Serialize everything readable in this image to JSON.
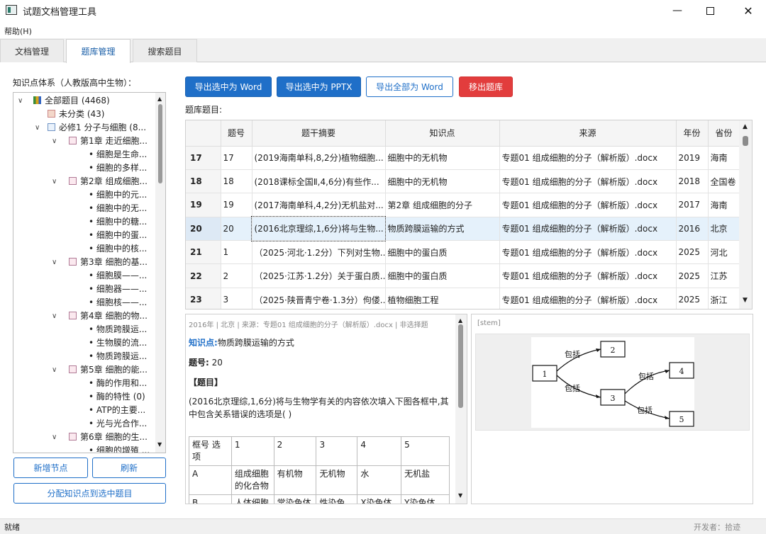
{
  "window": {
    "title": "试题文档管理工具",
    "min_icon": "minimize-icon",
    "max_icon": "maximize-icon",
    "close_icon": "close-icon"
  },
  "menu": {
    "help": "帮助(H)"
  },
  "tabs": [
    {
      "label": "文档管理"
    },
    {
      "label": "题库管理"
    },
    {
      "label": "搜索题目"
    }
  ],
  "left": {
    "title": "知识点体系（人教版高中生物）：",
    "tree": [
      {
        "label": "全部题目 (4468)",
        "level": 0,
        "expanded": true,
        "icon": "color-blocks-icon"
      },
      {
        "label": "未分类 (43)",
        "level": 1,
        "icon": "note-icon"
      },
      {
        "label": "必修1 分子与细胞 (8...",
        "level": 1,
        "expanded": true,
        "icon": "book-icon"
      },
      {
        "label": "第1章 走近细胞...",
        "level": 2,
        "expanded": true,
        "icon": "doc-icon"
      },
      {
        "label": "细胞是生命...",
        "level": 3
      },
      {
        "label": "细胞的多样...",
        "level": 3
      },
      {
        "label": "第2章 组成细胞...",
        "level": 2,
        "expanded": true,
        "icon": "doc-icon"
      },
      {
        "label": "细胞中的元...",
        "level": 3
      },
      {
        "label": "细胞中的无...",
        "level": 3
      },
      {
        "label": "细胞中的糖...",
        "level": 3
      },
      {
        "label": "细胞中的蛋...",
        "level": 3
      },
      {
        "label": "细胞中的核...",
        "level": 3
      },
      {
        "label": "第3章 细胞的基...",
        "level": 2,
        "expanded": true,
        "icon": "doc-icon"
      },
      {
        "label": "细胞膜——...",
        "level": 3
      },
      {
        "label": "细胞器——...",
        "level": 3
      },
      {
        "label": "细胞核——...",
        "level": 3
      },
      {
        "label": "第4章 细胞的物...",
        "level": 2,
        "expanded": true,
        "icon": "doc-icon"
      },
      {
        "label": "物质跨膜运...",
        "level": 3
      },
      {
        "label": "生物膜的流...",
        "level": 3
      },
      {
        "label": "物质跨膜运...",
        "level": 3
      },
      {
        "label": "第5章 细胞的能...",
        "level": 2,
        "expanded": true,
        "icon": "doc-icon"
      },
      {
        "label": "酶的作用和...",
        "level": 3
      },
      {
        "label": "酶的特性 (0)",
        "level": 3
      },
      {
        "label": "ATP的主要...",
        "level": 3
      },
      {
        "label": "光与光合作...",
        "level": 3
      },
      {
        "label": "第6章 细胞的生...",
        "level": 2,
        "expanded": true,
        "icon": "doc-icon"
      },
      {
        "label": "细胞的增殖 ...",
        "level": 3
      }
    ],
    "add_node": "新增节点",
    "refresh": "刷新",
    "assign": "分配知识点到选中题目"
  },
  "toolbar": {
    "export_word": "导出选中为 Word",
    "export_pptx": "导出选中为 PPTX",
    "export_all": "导出全部为 Word",
    "remove": "移出题库"
  },
  "table": {
    "label": "题库题目:",
    "headers": [
      "题号",
      "题干摘要",
      "知识点",
      "来源",
      "年份",
      "省份"
    ],
    "rows": [
      {
        "rh": "17",
        "no": "17",
        "stem": "(2019海南单科,8,2分)植物细胞...",
        "kp": "细胞中的无机物",
        "src": "专题01 组成细胞的分子（解析版）.docx",
        "year": "2019",
        "prov": "海南"
      },
      {
        "rh": "18",
        "no": "18",
        "stem": "(2018课标全国Ⅱ,4,6分)有些作...",
        "kp": "细胞中的无机物",
        "src": "专题01 组成细胞的分子（解析版）.docx",
        "year": "2018",
        "prov": "全国卷"
      },
      {
        "rh": "19",
        "no": "19",
        "stem": "(2017海南单科,4,2分)无机盐对...",
        "kp": "第2章 组成细胞的分子",
        "src": "专题01 组成细胞的分子（解析版）.docx",
        "year": "2017",
        "prov": "海南"
      },
      {
        "rh": "20",
        "no": "20",
        "stem": "(2016北京理综,1,6分)将与生物...",
        "kp": "物质跨膜运输的方式",
        "src": "专题01 组成细胞的分子（解析版）.docx",
        "year": "2016",
        "prov": "北京",
        "selected": true
      },
      {
        "rh": "21",
        "no": "1",
        "stem": "（2025·河北·1.2分）下列对生物...",
        "kp": "细胞中的蛋白质",
        "src": "专题01 组成细胞的分子（解析版）.docx",
        "year": "2025",
        "prov": "河北"
      },
      {
        "rh": "22",
        "no": "2",
        "stem": "（2025·江苏·1.2分）关于蛋白质...",
        "kp": "细胞中的蛋白质",
        "src": "专题01 组成细胞的分子（解析版）.docx",
        "year": "2025",
        "prov": "江苏"
      },
      {
        "rh": "23",
        "no": "3",
        "stem": "（2025·陕晋青宁卷·1.3分）佝偻...",
        "kp": "植物细胞工程",
        "src": "专题01 组成细胞的分子（解析版）.docx",
        "year": "2025",
        "prov": "浙江"
      }
    ]
  },
  "detail": {
    "meta": "2016年 | 北京 | 来源：专题01 组成细胞的分子（解析版）.docx | 非选择题",
    "kp_label": "知识点:",
    "kp_value": "物质跨膜运输的方式",
    "no_label": "题号:",
    "no_value": "20",
    "section": "【题目】",
    "question": "(2016北京理综,1,6分)将与生物学有关的内容依次填入下图各框中,其中包含关系错误的选项是( )",
    "options_table": [
      [
        "框号 选项",
        "1",
        "2",
        "3",
        "4",
        "5"
      ],
      [
        "A",
        "组成细胞的化合物",
        "有机物",
        "无机物",
        "水",
        "无机盐"
      ],
      [
        "B",
        "人体细胞",
        "常染色体",
        "性染色",
        "X染色体",
        "Y染色体"
      ]
    ]
  },
  "stem_panel": {
    "label": "[stem]",
    "diagram": {
      "boxes": [
        "1",
        "2",
        "3",
        "4",
        "5"
      ],
      "arrows": [
        "包括",
        "包括",
        "包括",
        "包括"
      ]
    }
  },
  "status": {
    "left": "就绪",
    "right": "开发者：拾迹"
  }
}
